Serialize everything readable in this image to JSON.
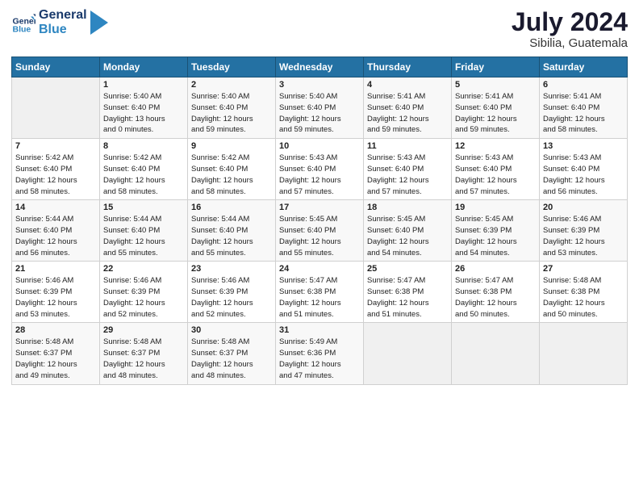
{
  "logo": {
    "general": "General",
    "blue": "Blue"
  },
  "header": {
    "title": "July 2024",
    "subtitle": "Sibilia, Guatemala"
  },
  "columns": [
    "Sunday",
    "Monday",
    "Tuesday",
    "Wednesday",
    "Thursday",
    "Friday",
    "Saturday"
  ],
  "weeks": [
    [
      {
        "day": "",
        "info": ""
      },
      {
        "day": "1",
        "info": "Sunrise: 5:40 AM\nSunset: 6:40 PM\nDaylight: 13 hours\nand 0 minutes."
      },
      {
        "day": "2",
        "info": "Sunrise: 5:40 AM\nSunset: 6:40 PM\nDaylight: 12 hours\nand 59 minutes."
      },
      {
        "day": "3",
        "info": "Sunrise: 5:40 AM\nSunset: 6:40 PM\nDaylight: 12 hours\nand 59 minutes."
      },
      {
        "day": "4",
        "info": "Sunrise: 5:41 AM\nSunset: 6:40 PM\nDaylight: 12 hours\nand 59 minutes."
      },
      {
        "day": "5",
        "info": "Sunrise: 5:41 AM\nSunset: 6:40 PM\nDaylight: 12 hours\nand 59 minutes."
      },
      {
        "day": "6",
        "info": "Sunrise: 5:41 AM\nSunset: 6:40 PM\nDaylight: 12 hours\nand 58 minutes."
      }
    ],
    [
      {
        "day": "7",
        "info": "Sunrise: 5:42 AM\nSunset: 6:40 PM\nDaylight: 12 hours\nand 58 minutes."
      },
      {
        "day": "8",
        "info": "Sunrise: 5:42 AM\nSunset: 6:40 PM\nDaylight: 12 hours\nand 58 minutes."
      },
      {
        "day": "9",
        "info": "Sunrise: 5:42 AM\nSunset: 6:40 PM\nDaylight: 12 hours\nand 58 minutes."
      },
      {
        "day": "10",
        "info": "Sunrise: 5:43 AM\nSunset: 6:40 PM\nDaylight: 12 hours\nand 57 minutes."
      },
      {
        "day": "11",
        "info": "Sunrise: 5:43 AM\nSunset: 6:40 PM\nDaylight: 12 hours\nand 57 minutes."
      },
      {
        "day": "12",
        "info": "Sunrise: 5:43 AM\nSunset: 6:40 PM\nDaylight: 12 hours\nand 57 minutes."
      },
      {
        "day": "13",
        "info": "Sunrise: 5:43 AM\nSunset: 6:40 PM\nDaylight: 12 hours\nand 56 minutes."
      }
    ],
    [
      {
        "day": "14",
        "info": "Sunrise: 5:44 AM\nSunset: 6:40 PM\nDaylight: 12 hours\nand 56 minutes."
      },
      {
        "day": "15",
        "info": "Sunrise: 5:44 AM\nSunset: 6:40 PM\nDaylight: 12 hours\nand 55 minutes."
      },
      {
        "day": "16",
        "info": "Sunrise: 5:44 AM\nSunset: 6:40 PM\nDaylight: 12 hours\nand 55 minutes."
      },
      {
        "day": "17",
        "info": "Sunrise: 5:45 AM\nSunset: 6:40 PM\nDaylight: 12 hours\nand 55 minutes."
      },
      {
        "day": "18",
        "info": "Sunrise: 5:45 AM\nSunset: 6:40 PM\nDaylight: 12 hours\nand 54 minutes."
      },
      {
        "day": "19",
        "info": "Sunrise: 5:45 AM\nSunset: 6:39 PM\nDaylight: 12 hours\nand 54 minutes."
      },
      {
        "day": "20",
        "info": "Sunrise: 5:46 AM\nSunset: 6:39 PM\nDaylight: 12 hours\nand 53 minutes."
      }
    ],
    [
      {
        "day": "21",
        "info": "Sunrise: 5:46 AM\nSunset: 6:39 PM\nDaylight: 12 hours\nand 53 minutes."
      },
      {
        "day": "22",
        "info": "Sunrise: 5:46 AM\nSunset: 6:39 PM\nDaylight: 12 hours\nand 52 minutes."
      },
      {
        "day": "23",
        "info": "Sunrise: 5:46 AM\nSunset: 6:39 PM\nDaylight: 12 hours\nand 52 minutes."
      },
      {
        "day": "24",
        "info": "Sunrise: 5:47 AM\nSunset: 6:38 PM\nDaylight: 12 hours\nand 51 minutes."
      },
      {
        "day": "25",
        "info": "Sunrise: 5:47 AM\nSunset: 6:38 PM\nDaylight: 12 hours\nand 51 minutes."
      },
      {
        "day": "26",
        "info": "Sunrise: 5:47 AM\nSunset: 6:38 PM\nDaylight: 12 hours\nand 50 minutes."
      },
      {
        "day": "27",
        "info": "Sunrise: 5:48 AM\nSunset: 6:38 PM\nDaylight: 12 hours\nand 50 minutes."
      }
    ],
    [
      {
        "day": "28",
        "info": "Sunrise: 5:48 AM\nSunset: 6:37 PM\nDaylight: 12 hours\nand 49 minutes."
      },
      {
        "day": "29",
        "info": "Sunrise: 5:48 AM\nSunset: 6:37 PM\nDaylight: 12 hours\nand 48 minutes."
      },
      {
        "day": "30",
        "info": "Sunrise: 5:48 AM\nSunset: 6:37 PM\nDaylight: 12 hours\nand 48 minutes."
      },
      {
        "day": "31",
        "info": "Sunrise: 5:49 AM\nSunset: 6:36 PM\nDaylight: 12 hours\nand 47 minutes."
      },
      {
        "day": "",
        "info": ""
      },
      {
        "day": "",
        "info": ""
      },
      {
        "day": "",
        "info": ""
      }
    ]
  ]
}
